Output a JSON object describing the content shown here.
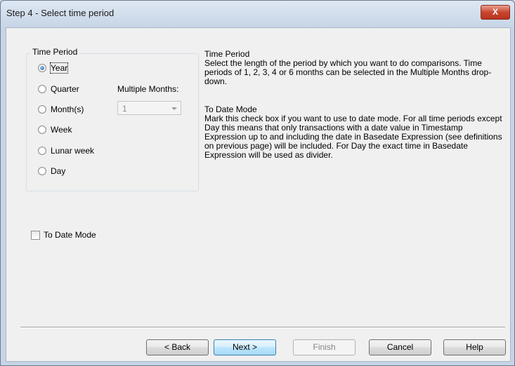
{
  "window": {
    "title": "Step 4 - Select time period",
    "close_label": "X"
  },
  "time_period": {
    "group_label": "Time Period",
    "options": [
      "Year",
      "Quarter",
      "Month(s)",
      "Week",
      "Lunar week",
      "Day"
    ],
    "selected": "Year"
  },
  "multiple_months": {
    "label": "Multiple Months:",
    "value": "1",
    "enabled": false
  },
  "help": {
    "time_period_heading": "Time Period",
    "time_period_text": "Select the length of the period by which you want to do comparisons. Time periods of 1, 2, 3, 4 or 6 months can be selected in the Multiple Months drop-down.",
    "to_date_heading": "To Date Mode",
    "to_date_text": "Mark this check box if you want to use to date mode. For all time periods except Day this means that only transactions with a date value in Timestamp Expression up to and including the date in Basedate Expression (see definitions on previous page) will be included. For Day the exact time in Basedate Expression will be used as divider."
  },
  "to_date_mode": {
    "label": "To Date Mode",
    "checked": false
  },
  "buttons": {
    "back": "< Back",
    "next": "Next >",
    "finish": "Finish",
    "cancel": "Cancel",
    "help": "Help"
  }
}
